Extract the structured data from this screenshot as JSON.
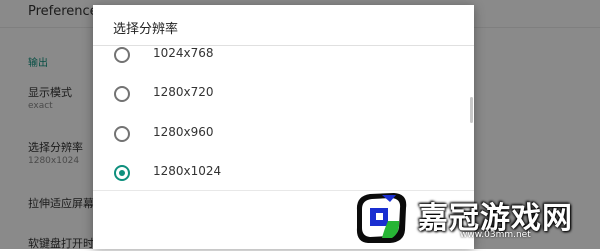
{
  "background": {
    "title": "Preferences",
    "section_header": "输出",
    "items": [
      {
        "title": "显示模式",
        "summary": "exact"
      },
      {
        "title": "选择分辨率",
        "summary": "1280x1024"
      },
      {
        "title": "拉伸适应屏幕"
      },
      {
        "title": "软键盘打开时重新调出屏幕"
      }
    ]
  },
  "dialog": {
    "title": "选择分辨率",
    "options": [
      {
        "label": "1024x768",
        "checked": false
      },
      {
        "label": "1280x720",
        "checked": false
      },
      {
        "label": "1280x960",
        "checked": false
      },
      {
        "label": "1280x1024",
        "checked": true
      }
    ]
  },
  "colors": {
    "accent": "#0e8f7d",
    "radio_unchecked": "#737373"
  },
  "watermark": {
    "text": "嘉冠游戏网",
    "url": "www.03mm.net",
    "logo_icon": "stylized-logo-icon"
  }
}
